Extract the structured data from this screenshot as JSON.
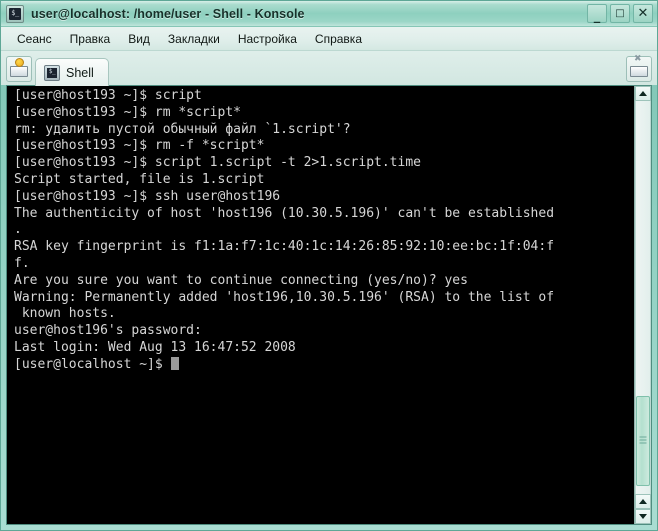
{
  "window": {
    "title": "user@localhost: /home/user - Shell - Konsole",
    "icon": "konsole-icon",
    "buttons": {
      "minimize": "_",
      "maximize": "□",
      "close": "✕"
    },
    "frame_color": "#8ecfc0"
  },
  "menubar": {
    "items": [
      {
        "label": "Сеанс"
      },
      {
        "label": "Правка"
      },
      {
        "label": "Вид"
      },
      {
        "label": "Закладки"
      },
      {
        "label": "Настройка"
      },
      {
        "label": "Справка"
      }
    ]
  },
  "tabbar": {
    "new_tab_icon": "new-session-icon",
    "close_tab_icon": "close-session-icon",
    "tabs": [
      {
        "label": "Shell",
        "icon": "shell-icon",
        "active": true
      }
    ]
  },
  "terminal": {
    "background": "#000000",
    "foreground": "#d6d6d6",
    "cursor": "block",
    "lines": [
      "[user@host193 ~]$ script",
      "[user@host193 ~]$ rm *script*",
      "rm: удалить пустой обычный файл `1.script'?",
      "[user@host193 ~]$ rm -f *script*",
      "[user@host193 ~]$ script 1.script -t 2>1.script.time",
      "Script started, file is 1.script",
      "[user@host193 ~]$ ssh user@host196",
      "The authenticity of host 'host196 (10.30.5.196)' can't be established",
      ".",
      "RSA key fingerprint is f1:1a:f7:1c:40:1c:14:26:85:92:10:ee:bc:1f:04:f",
      "f.",
      "Are you sure you want to continue connecting (yes/no)? yes",
      "Warning: Permanently added 'host196,10.30.5.196' (RSA) to the list of",
      " known hosts.",
      "user@host196's password:",
      "Last login: Wed Aug 13 16:47:52 2008"
    ],
    "prompt_line": "[user@localhost ~]$ "
  },
  "scrollbar": {
    "up_arrow": "scroll-up-icon",
    "down_arrow": "scroll-down-icon",
    "thumb_top_percent": 75,
    "thumb_height_percent": 23
  }
}
